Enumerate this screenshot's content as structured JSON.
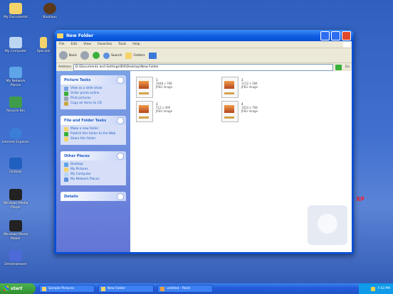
{
  "desktop": {
    "icons": [
      {
        "label": "My Documents",
        "color": "#f4d36b"
      },
      {
        "label": "My Computer",
        "color": "#bcd6f2"
      },
      {
        "label": "My Network Places",
        "color": "#5ea4e8"
      },
      {
        "label": "Recycle Bin",
        "color": "#3f9c4a"
      },
      {
        "label": "Internet Explorer",
        "color": "#3b7ed8"
      },
      {
        "label": "Outlook",
        "color": "#1f5fbf"
      },
      {
        "label": "Windows Media Player",
        "color": "#222222"
      },
      {
        "label": "Windows Movie Maker",
        "color": "#222222"
      },
      {
        "label": "Dreamweaver",
        "color": "#4c6ad8"
      }
    ],
    "top_icon2": {
      "label": "Bauhaus",
      "color": "#5a3a1a"
    },
    "top_icon3": {
      "label": "Specials",
      "color": "#f4d36b"
    },
    "side_text": "XP"
  },
  "window": {
    "title": "New Folder",
    "menu": [
      "File",
      "Edit",
      "View",
      "Favorites",
      "Tools",
      "Help"
    ],
    "toolbar": {
      "back": "Back",
      "search": "Search",
      "folders": "Folders"
    },
    "address_label": "Address",
    "address_value": "D:\\Documents and Settings\\Bill\\Desktop\\New Folder",
    "go_label": "Go"
  },
  "left_pane": {
    "panels": [
      {
        "title": "Picture Tasks",
        "items": [
          "View as a slide show",
          "Order prints online",
          "Print pictures",
          "Copy all items to CD"
        ]
      },
      {
        "title": "File and Folder Tasks",
        "items": [
          "Make a new folder",
          "Publish this folder to the Web",
          "Share this folder"
        ]
      },
      {
        "title": "Other Places",
        "items": [
          "Desktop",
          "My Pictures",
          "My Computer",
          "My Network Places"
        ]
      },
      {
        "title": "Details",
        "items": []
      }
    ]
  },
  "files": [
    {
      "name": "1",
      "dims": "2048 x 768",
      "type": "JPEG Image"
    },
    {
      "name": "2",
      "dims": "1152 x 384",
      "type": "JPEG Image"
    },
    {
      "name": "3",
      "dims": "512 x 400",
      "type": "JPEG Image"
    },
    {
      "name": "4",
      "dims": "1024 x 768",
      "type": "JPEG Image"
    }
  ],
  "taskbar": {
    "start_label": "start",
    "tasks": [
      "Sample Pictures",
      "New Folder",
      "untitled - Paint"
    ],
    "clock": "7:43 PM"
  }
}
